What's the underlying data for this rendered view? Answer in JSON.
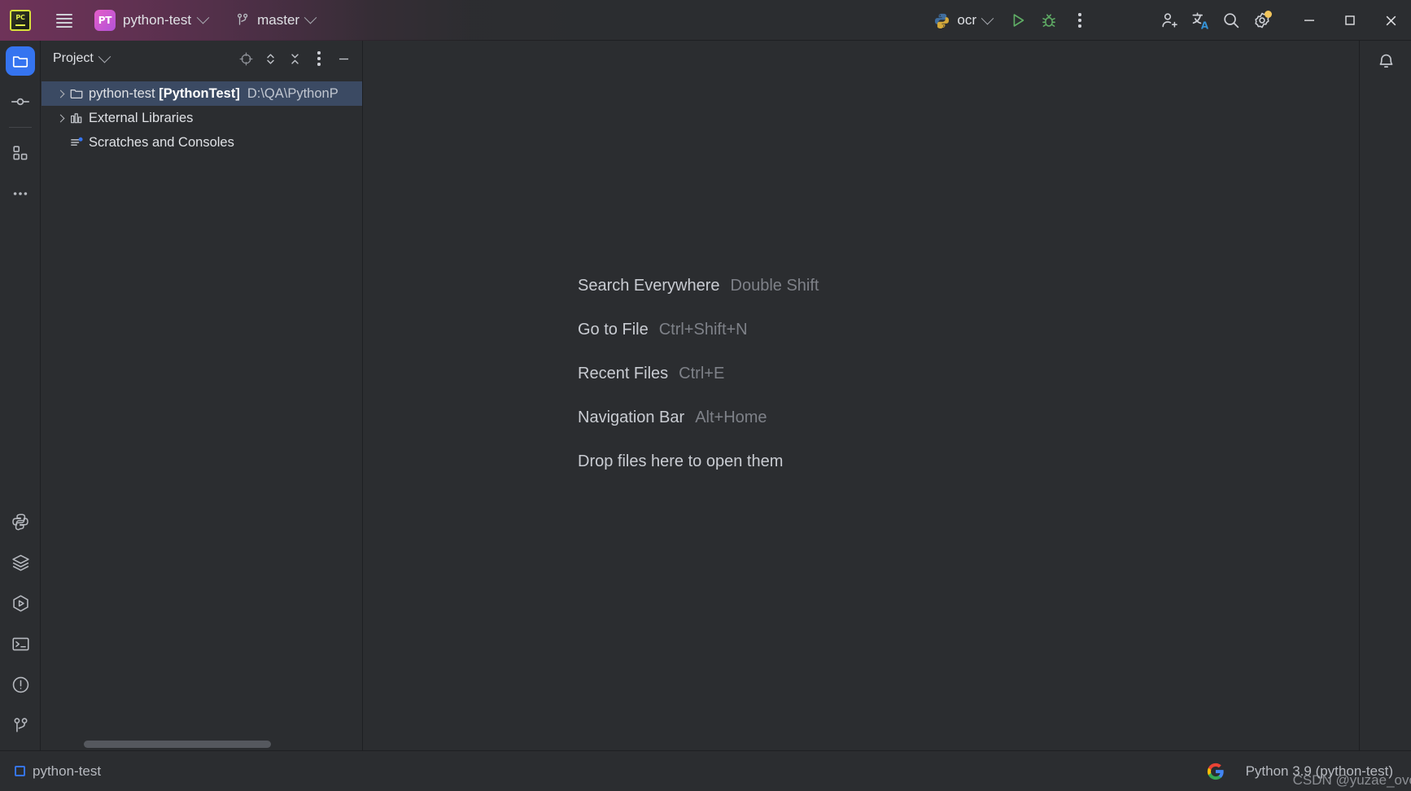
{
  "titlebar": {
    "logo_icon": "pycharm-logo-icon",
    "menu_icon": "hamburger-menu-icon",
    "project_badge": "PT",
    "project_name": "python-test",
    "project_chevron_icon": "chevron-down-icon",
    "vcs_icon": "git-branch-icon",
    "branch_name": "master",
    "branch_chevron_icon": "chevron-down-icon",
    "run_config_icon": "python-logo-icon",
    "run_config_name": "ocr",
    "run_config_chevron_icon": "chevron-down-icon",
    "run_icon": "run-play-icon",
    "debug_icon": "debug-bug-icon",
    "more_icon": "more-vertical-icon",
    "share_icon": "add-user-icon",
    "translate_icon": "translate-icon",
    "search_icon": "search-icon",
    "settings_icon": "gear-icon",
    "settings_badge": true,
    "minimize_icon": "window-minimize-icon",
    "maximize_icon": "window-maximize-icon",
    "close_icon": "window-close-icon",
    "accent": "#7a3460"
  },
  "left_stripe": {
    "top_items": [
      {
        "name": "project-tool-window",
        "icon": "folder-icon",
        "active": true
      },
      {
        "name": "commit-tool-window",
        "icon": "commit-node-icon",
        "active": false
      },
      {
        "name": "structure-tool-window",
        "icon": "structure-blocks-icon",
        "active": false
      },
      {
        "name": "more-tool-windows",
        "icon": "more-horizontal-icon",
        "active": false
      }
    ],
    "bottom_items": [
      {
        "name": "python-console-tool-window",
        "icon": "python-logo-icon"
      },
      {
        "name": "database-tool-window",
        "icon": "layers-icon"
      },
      {
        "name": "run-tool-window",
        "icon": "run-hexagon-icon"
      },
      {
        "name": "terminal-tool-window",
        "icon": "terminal-icon"
      },
      {
        "name": "problems-tool-window",
        "icon": "warning-circle-icon"
      },
      {
        "name": "version-control-tool-window",
        "icon": "git-branch-icon"
      }
    ]
  },
  "project_panel": {
    "title": "Project",
    "title_chevron_icon": "chevron-down-icon",
    "toolbar": [
      {
        "name": "select-opened-file-button",
        "icon": "crosshair-target-icon"
      },
      {
        "name": "expand-collapse-button",
        "icon": "expand-collapse-icon"
      },
      {
        "name": "collapse-all-button",
        "icon": "collapse-all-icon"
      },
      {
        "name": "panel-options-button",
        "icon": "more-vertical-icon"
      },
      {
        "name": "hide-panel-button",
        "icon": "minimize-dash-icon"
      }
    ],
    "tree": [
      {
        "name": "tree-node-project-root",
        "icon": "folder-icon",
        "arrow": true,
        "label": "python-test ",
        "bold": "[PythonTest]",
        "path": "D:\\QA\\PythonP",
        "selected": true
      },
      {
        "name": "tree-node-external-libraries",
        "icon": "library-icon",
        "arrow": true,
        "label": "External Libraries",
        "bold": "",
        "path": "",
        "selected": false
      },
      {
        "name": "tree-node-scratches-and-consoles",
        "icon": "scratches-icon",
        "arrow": false,
        "label": "Scratches and Consoles",
        "bold": "",
        "path": "",
        "selected": false
      }
    ]
  },
  "editor": {
    "tips": [
      {
        "label": "Search Everywhere",
        "key": "Double Shift"
      },
      {
        "label": "Go to File",
        "key": "Ctrl+Shift+N"
      },
      {
        "label": "Recent Files",
        "key": "Ctrl+E"
      },
      {
        "label": "Navigation Bar",
        "key": "Alt+Home"
      }
    ],
    "drop_hint": "Drop files here to open them"
  },
  "right_stripe": {
    "items": [
      {
        "name": "notifications-tool-window",
        "icon": "bell-icon"
      }
    ]
  },
  "statusbar": {
    "project_indicator_icon": "blue-square-icon",
    "project_label": "python-test",
    "google_icon": "google-g-icon",
    "interpreter": "Python 3.9 (python-test)",
    "watermark": "CSDN @yuzae_ovo"
  }
}
